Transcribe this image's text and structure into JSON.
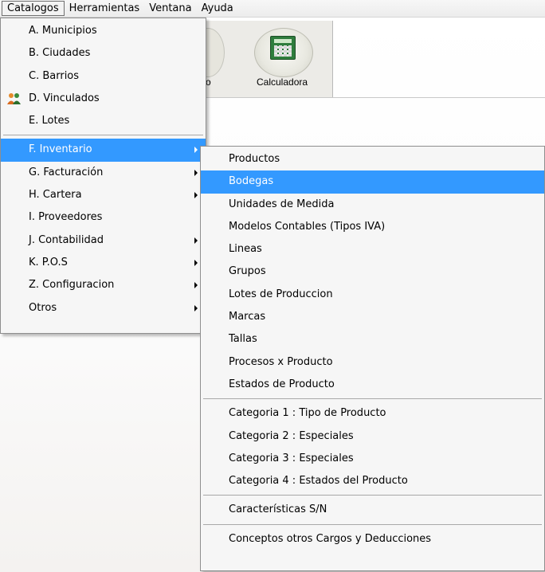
{
  "menubar": {
    "items": [
      "Catalogos",
      "Herramientas",
      "Ventana",
      "Ayuda"
    ]
  },
  "toolbar": {
    "left_label_fragment": "o",
    "calculator_label": "Calculadora"
  },
  "catalogos_menu": {
    "group1": [
      "A. Municipios",
      "B. Ciudades",
      "C. Barrios",
      "D. Vinculados",
      "E. Lotes"
    ],
    "group2": [
      "F. Inventario",
      "G. Facturación",
      "H. Cartera",
      "I. Proveedores",
      "J. Contabilidad",
      "K. P.O.S",
      "Z. Configuracion",
      "Otros"
    ],
    "selected": "F. Inventario"
  },
  "inventario_menu": {
    "group1": [
      "Productos",
      "Bodegas",
      "Unidades de Medida",
      "Modelos Contables (Tipos IVA)",
      "Lineas",
      "Grupos",
      "Lotes de Produccion",
      "Marcas",
      "Tallas",
      "Procesos x Producto",
      "Estados de Producto"
    ],
    "group2": [
      "Categoria 1 : Tipo de Producto",
      "Categoria 2 : Especiales",
      "Categoria 3 : Especiales",
      "Categoria 4 : Estados del Producto"
    ],
    "group3": [
      "Características S/N"
    ],
    "group4": [
      "Conceptos otros Cargos y Deducciones"
    ],
    "selected": "Bodegas"
  },
  "icons": {
    "vinculados": "people-icon",
    "calculator": "calculator-icon",
    "submenu_arrow": "chevron-right-icon"
  },
  "colors": {
    "selection": "#3399ff",
    "menu_bg": "#f6f6f6"
  }
}
